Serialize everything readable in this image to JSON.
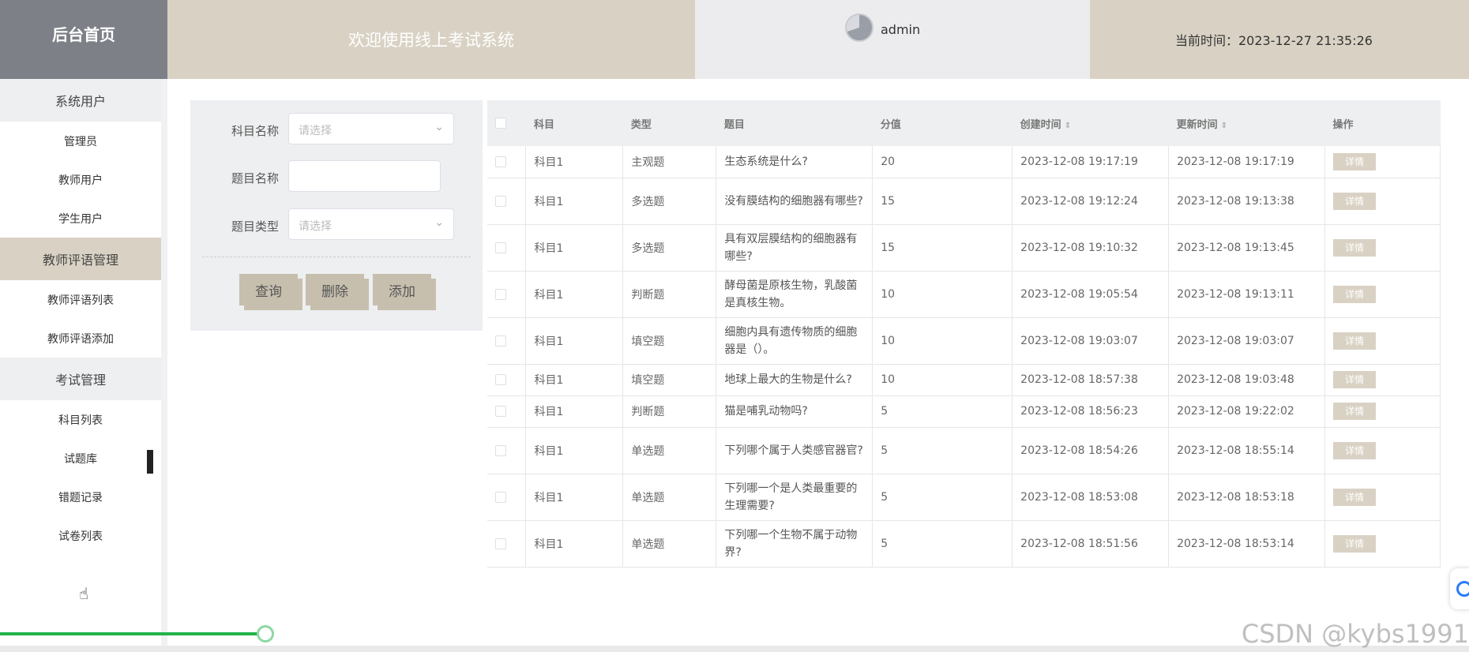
{
  "header": {
    "logo": "后台首页",
    "welcome": "欢迎使用线上考试系统",
    "username": "admin",
    "time_label": "当前时间：2023-12-27 21:35:26"
  },
  "sidebar": {
    "groups": [
      {
        "label": "系统用户",
        "items": [
          "管理员",
          "教师用户",
          "学生用户"
        ]
      },
      {
        "label": "教师评语管理",
        "items": [
          "教师评语列表",
          "教师评语添加"
        ]
      },
      {
        "label": "考试管理",
        "items": [
          "科目列表",
          "试题库",
          "错题记录",
          "试卷列表"
        ]
      }
    ]
  },
  "search": {
    "subject_label": "科目名称",
    "subject_placeholder": "请选择",
    "title_label": "题目名称",
    "title_value": "",
    "type_label": "题目类型",
    "type_placeholder": "请选择",
    "buttons": {
      "query": "查询",
      "delete": "删除",
      "add": "添加"
    }
  },
  "table": {
    "headers": [
      "科目",
      "类型",
      "题目",
      "分值",
      "创建时间",
      "更新时间",
      "操作"
    ],
    "detail_label": "详情",
    "rows": [
      {
        "subject": "科目1",
        "type": "主观题",
        "question": "生态系统是什么?",
        "score": "20",
        "created": "2023-12-08 19:17:19",
        "updated": "2023-12-08 19:17:19"
      },
      {
        "subject": "科目1",
        "type": "多选题",
        "question": "没有膜结构的细胞器有哪些?",
        "score": "15",
        "created": "2023-12-08 19:12:24",
        "updated": "2023-12-08 19:13:38"
      },
      {
        "subject": "科目1",
        "type": "多选题",
        "question": "具有双层膜结构的细胞器有哪些?",
        "score": "15",
        "created": "2023-12-08 19:10:32",
        "updated": "2023-12-08 19:13:45"
      },
      {
        "subject": "科目1",
        "type": "判断题",
        "question": "酵母菌是原核生物，乳酸菌是真核生物。",
        "score": "10",
        "created": "2023-12-08 19:05:54",
        "updated": "2023-12-08 19:13:11"
      },
      {
        "subject": "科目1",
        "type": "填空题",
        "question": "细胞内具有遗传物质的细胞器是（）。",
        "score": "10",
        "created": "2023-12-08 19:03:07",
        "updated": "2023-12-08 19:03:07"
      },
      {
        "subject": "科目1",
        "type": "填空题",
        "question": "地球上最大的生物是什么?",
        "score": "10",
        "created": "2023-12-08 18:57:38",
        "updated": "2023-12-08 19:03:48"
      },
      {
        "subject": "科目1",
        "type": "判断题",
        "question": "猫是哺乳动物吗?",
        "score": "5",
        "created": "2023-12-08 18:56:23",
        "updated": "2023-12-08 19:22:02"
      },
      {
        "subject": "科目1",
        "type": "单选题",
        "question": "下列哪个属于人类感官器官?",
        "score": "5",
        "created": "2023-12-08 18:54:26",
        "updated": "2023-12-08 18:55:14"
      },
      {
        "subject": "科目1",
        "type": "单选题",
        "question": "下列哪一个是人类最重要的生理需要?",
        "score": "5",
        "created": "2023-12-08 18:53:08",
        "updated": "2023-12-08 18:53:18"
      },
      {
        "subject": "科目1",
        "type": "单选题",
        "question": "下列哪一个生物不属于动物界?",
        "score": "5",
        "created": "2023-12-08 18:51:56",
        "updated": "2023-12-08 18:53:14"
      }
    ]
  },
  "progress": 0.18,
  "watermark": "CSDN @kybs1991"
}
